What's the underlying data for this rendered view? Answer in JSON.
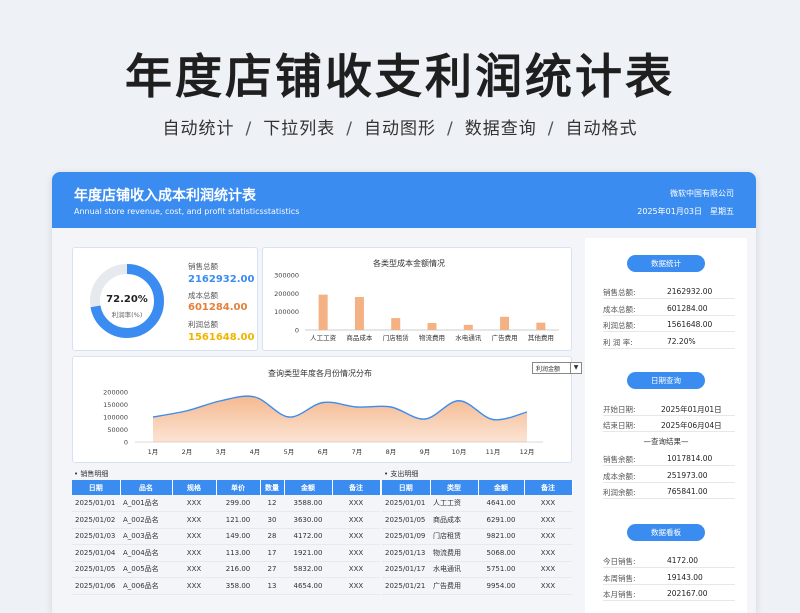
{
  "hero": {
    "title": "年度店铺收支利润统计表",
    "features": [
      "自动统计",
      "下拉列表",
      "自动图形",
      "数据查询",
      "自动格式"
    ]
  },
  "sheet": {
    "title": "年度店铺收入成本利润统计表",
    "subtitle": "Annual store revenue, cost, and profit statisticsstatistics",
    "company": "微软中国有限公司",
    "date": "2025年01月03日",
    "weekday": "星期五"
  },
  "kpi": {
    "ratio": "72.20%",
    "ratio_fraction": 0.722,
    "ratio_label": "利润率(%)",
    "sales_label": "销售总额",
    "sales_value": "2162932.00",
    "cost_label": "成本总额",
    "cost_value": "601284.00",
    "profit_label": "利润总额",
    "profit_value": "1561648.00",
    "colors": {
      "sales": "#3b8cf0",
      "cost": "#e3813a",
      "profit": "#f0b400",
      "ring": "#3b8cf0",
      "ring_bg": "#e6e9ee"
    }
  },
  "chart_data": [
    {
      "type": "bar",
      "title": "各类型成本金额情况",
      "categories": [
        "人工工资",
        "商品成本",
        "门店租赁",
        "物流费用",
        "水电通讯",
        "广告费用",
        "其他费用"
      ],
      "values": [
        193000,
        180000,
        65000,
        38000,
        28000,
        72000,
        40000
      ],
      "ylim": [
        0,
        300000
      ],
      "yticks": [
        "300000",
        "200000",
        "100000",
        "0"
      ],
      "color": "#f4b183"
    },
    {
      "type": "area",
      "title": "查询类型年度各月份情况分布",
      "categories": [
        "1月",
        "2月",
        "3月",
        "4月",
        "5月",
        "6月",
        "7月",
        "8月",
        "9月",
        "10月",
        "11月",
        "12月"
      ],
      "values": [
        100000,
        125000,
        165000,
        180000,
        100000,
        158000,
        140000,
        140000,
        92000,
        165000,
        90000,
        120000
      ],
      "ylim": [
        0,
        200000
      ],
      "yticks": [
        "200000",
        "150000",
        "100000",
        "50000",
        "0"
      ],
      "line_color": "#3b8cf0",
      "fill_color": "#f4b183"
    }
  ],
  "dropdown": {
    "value": "利润金额",
    "arrow": "▼"
  },
  "sales_table": {
    "section": "销售明细",
    "headers": [
      "日期",
      "品名",
      "规格",
      "单价",
      "数量",
      "金额",
      "备注"
    ],
    "rows": [
      [
        "2025/01/01",
        "A_001品名",
        "XXX",
        "299.00",
        "12",
        "3588.00",
        "XXX"
      ],
      [
        "2025/01/02",
        "A_002品名",
        "XXX",
        "121.00",
        "30",
        "3630.00",
        "XXX"
      ],
      [
        "2025/01/03",
        "A_003品名",
        "XXX",
        "149.00",
        "28",
        "4172.00",
        "XXX"
      ],
      [
        "2025/01/04",
        "A_004品名",
        "XXX",
        "113.00",
        "17",
        "1921.00",
        "XXX"
      ],
      [
        "2025/01/05",
        "A_005品名",
        "XXX",
        "216.00",
        "27",
        "5832.00",
        "XXX"
      ],
      [
        "2025/01/06",
        "A_006品名",
        "XXX",
        "358.00",
        "13",
        "4654.00",
        "XXX"
      ]
    ]
  },
  "expense_table": {
    "section": "支出明细",
    "headers": [
      "日期",
      "类型",
      "金额",
      "备注"
    ],
    "rows": [
      [
        "2025/01/01",
        "人工工资",
        "4641.00",
        "XXX"
      ],
      [
        "2025/01/05",
        "商品成本",
        "6291.00",
        "XXX"
      ],
      [
        "2025/01/09",
        "门店租赁",
        "9821.00",
        "XXX"
      ],
      [
        "2025/01/13",
        "物流费用",
        "5068.00",
        "XXX"
      ],
      [
        "2025/01/17",
        "水电通讯",
        "5751.00",
        "XXX"
      ],
      [
        "2025/01/21",
        "广告费用",
        "9954.00",
        "XXX"
      ]
    ]
  },
  "side": {
    "stats_title": "数据统计",
    "stats": [
      {
        "k": "销售总额:",
        "v": "2162932.00"
      },
      {
        "k": "成本总额:",
        "v": "601284.00"
      },
      {
        "k": "利润总额:",
        "v": "1561648.00"
      },
      {
        "k": "利 润 率:",
        "v": "72.20%"
      }
    ],
    "query_title": "日期查询",
    "query_start_label": "开始日期:",
    "query_start": "2025年01月01日",
    "query_end_label": "结束日期:",
    "query_end": "2025年06月04日",
    "query_result": "—查询结果—",
    "results": [
      {
        "k": "销售余额:",
        "v": "1017814.00"
      },
      {
        "k": "成本余额:",
        "v": "251973.00"
      },
      {
        "k": "利润余额:",
        "v": "765841.00"
      }
    ],
    "board_title": "数据看板",
    "board": [
      {
        "k": "今日销售:",
        "v": "4172.00"
      },
      {
        "k": "本周销售:",
        "v": "19143.00"
      },
      {
        "k": "本月销售:",
        "v": "202167.00"
      }
    ]
  }
}
